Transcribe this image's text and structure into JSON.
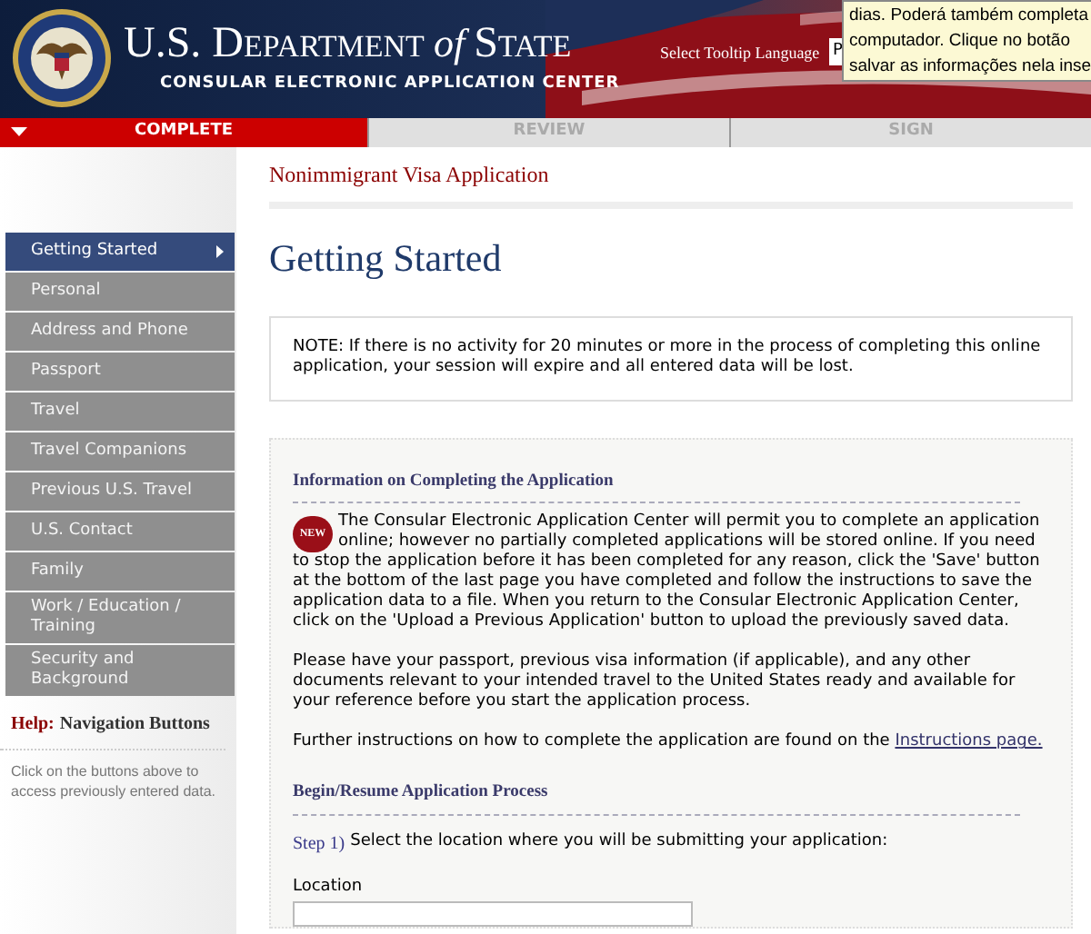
{
  "header": {
    "title_main": "U.S. Department",
    "title_of": "of",
    "title_state": "State",
    "subtitle": "CONSULAR ELECTRONIC APPLICATION CENTER",
    "tooltip_language_label": "Select Tooltip Language",
    "tooltip_language_value": "P"
  },
  "tooltip": {
    "lines": [
      "dias. Poderá também completa",
      "computador. Clique no botão",
      "salvar as informações nela inse"
    ]
  },
  "progress_tabs": [
    {
      "label": "COMPLETE",
      "selected": true
    },
    {
      "label": "REVIEW",
      "selected": false
    },
    {
      "label": "SIGN",
      "selected": false
    }
  ],
  "page_title": "Nonimmigrant Visa Application",
  "sidebar": {
    "items": [
      {
        "label": "Getting Started",
        "selected": true
      },
      {
        "label": "Personal",
        "selected": false
      },
      {
        "label": "Address and Phone",
        "selected": false
      },
      {
        "label": "Passport",
        "selected": false
      },
      {
        "label": "Travel",
        "selected": false
      },
      {
        "label": "Travel Companions",
        "selected": false
      },
      {
        "label": "Previous U.S. Travel",
        "selected": false
      },
      {
        "label": "U.S. Contact",
        "selected": false
      },
      {
        "label": "Family",
        "selected": false
      },
      {
        "label": "Work / Education / Training",
        "selected": false
      },
      {
        "label": "Security and Background",
        "selected": false
      }
    ],
    "help_label": "Help:",
    "help_title": "Navigation Buttons",
    "help_text": "Click on the buttons above to access previously entered data."
  },
  "heading": "Getting Started",
  "note": "NOTE: If there is no activity for 20 minutes or more in the process of completing this online application, your session will expire and all entered data will be lost.",
  "info": {
    "title": "Information on Completing the Application",
    "badge": "NEW",
    "paragraph_1": "The Consular Electronic Application Center will permit you to complete an application online; however no partially completed applications will be stored online. If you need to stop the application before it has been completed for any reason, click the 'Save' button at the bottom of the last page you have completed and follow the instructions to save the application data to a file. When you return to the Consular Electronic Application Center, click on the 'Upload a Previous Application' button to upload the previously saved data.",
    "paragraph_2": "Please have your passport, previous visa information (if applicable), and any other documents relevant to your intended travel to the United States ready and available for your reference before you start the application process.",
    "paragraph_3": "Further instructions on how to complete the application are found on the",
    "link": "Instructions page."
  },
  "begin": {
    "title": "Begin/Resume Application Process",
    "step_label": "Step 1)",
    "step_text": "Select the location where you will be submitting your application:",
    "location_label": "Location"
  }
}
